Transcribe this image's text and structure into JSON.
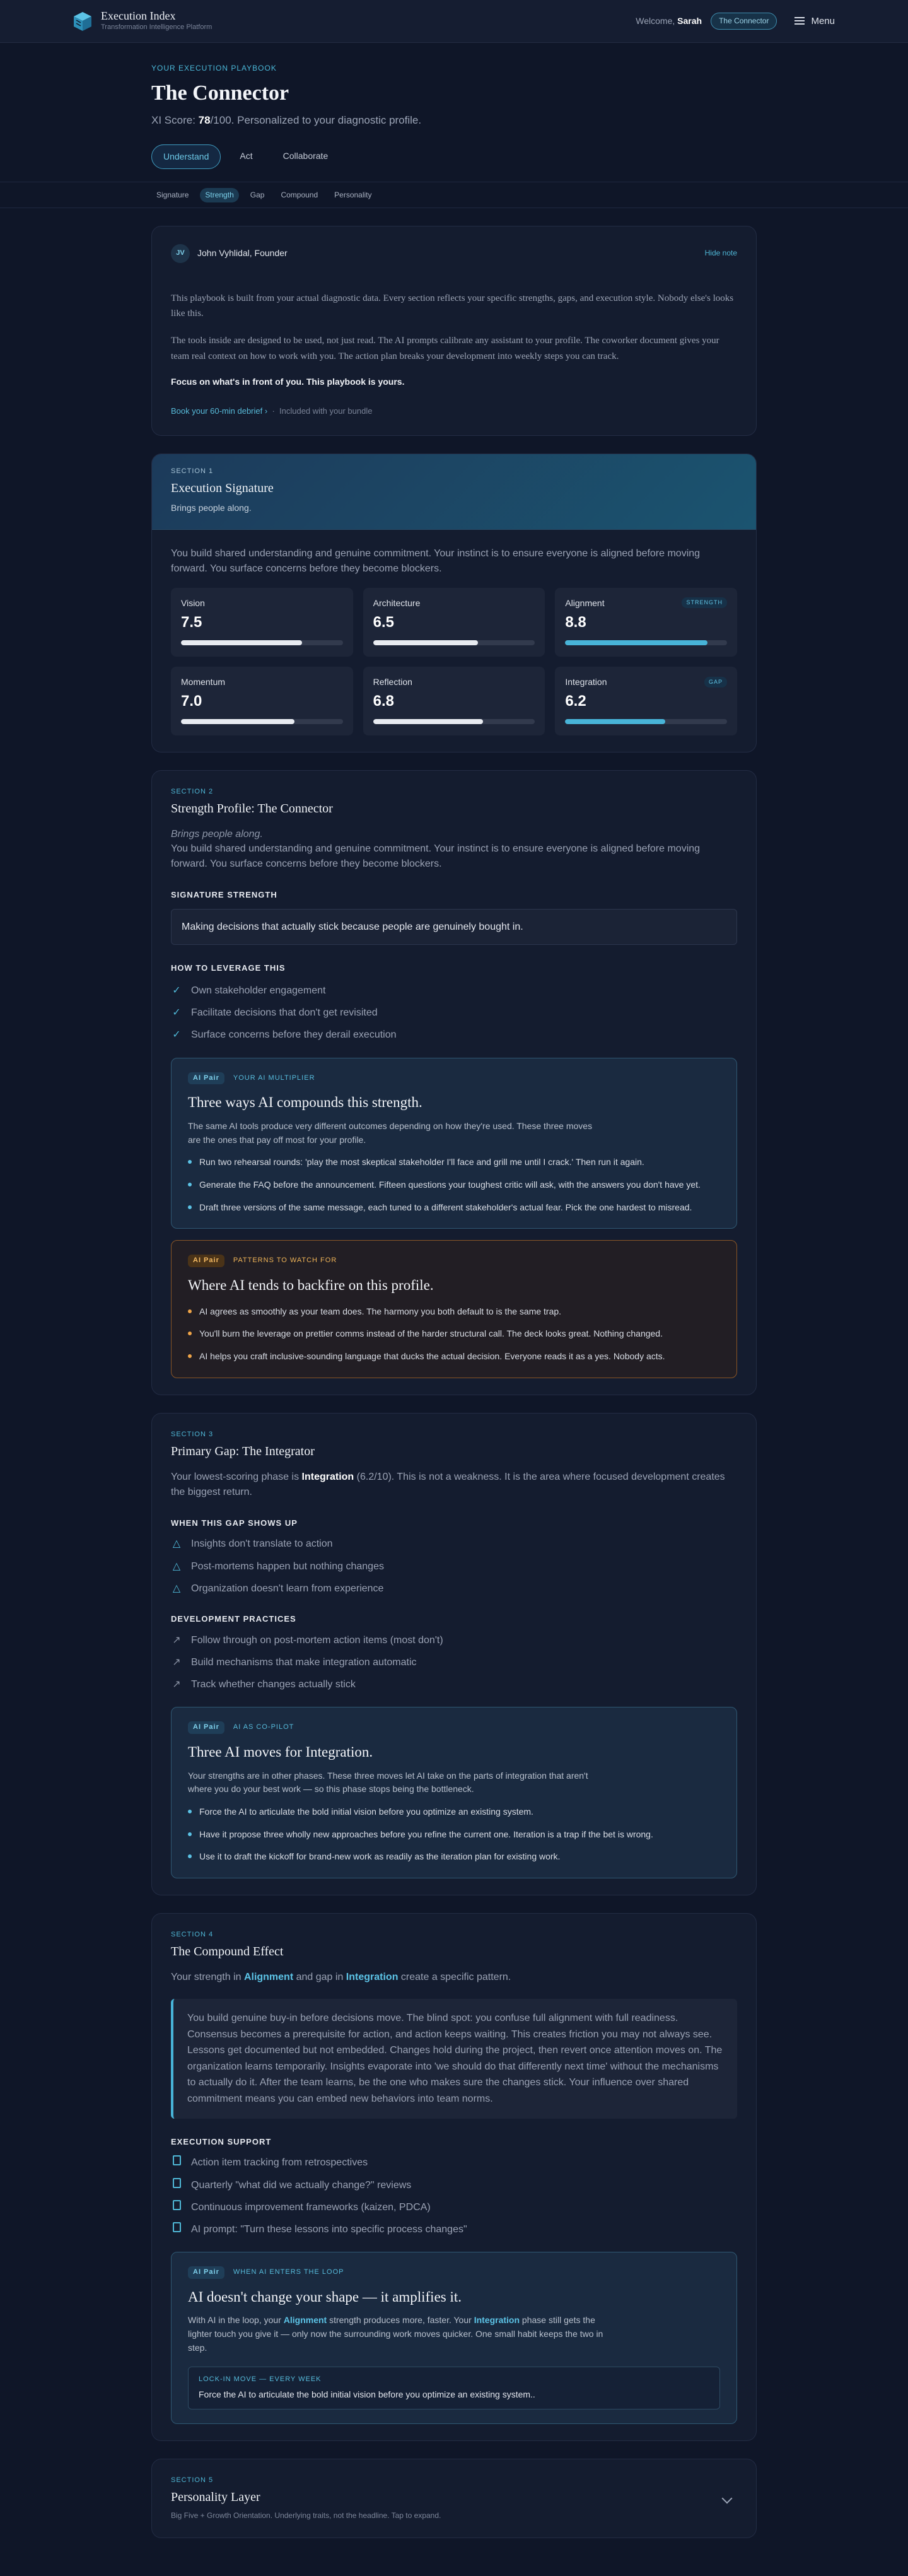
{
  "header": {
    "brand_title": "Execution Index",
    "brand_sub": "Transformation Intelligence Platform",
    "welcome": "Welcome,",
    "user": "Sarah",
    "profile_pill": "The Connector",
    "menu": "Menu"
  },
  "hero": {
    "kicker": "Your Execution Playbook",
    "title": "The Connector",
    "score_prefix": "XI Score:",
    "score": "78",
    "score_suffix": "/100. Personalized to your diagnostic profile."
  },
  "tabs": [
    "Understand",
    "Act",
    "Collaborate"
  ],
  "subnav": [
    "Signature",
    "Strength",
    "Gap",
    "Compound",
    "Personality"
  ],
  "note": {
    "initials": "JV",
    "author": "John Vyhlidal, Founder",
    "hide": "Hide note",
    "p1": "This playbook is built from your actual diagnostic data. Every section reflects your specific strengths, gaps, and execution style. Nobody else's looks like this.",
    "p2": "The tools inside are designed to be used, not just read. The AI prompts calibrate any assistant to your profile. The coworker document gives your team real context on how to work with you. The action plan breaks your development into weekly steps you can track.",
    "focus": "Focus on what's in front of you. This playbook is yours.",
    "book": "Book your 60-min debrief",
    "book_arrow": "›",
    "included": "Included with your bundle"
  },
  "s1": {
    "label": "Section 1",
    "title": "Execution Signature",
    "tag": "Brings people along.",
    "lead": "You build shared understanding and genuine commitment. Your instinct is to ensure everyone is aligned before moving forward. You surface concerns before they become blockers.",
    "metrics": [
      {
        "name": "Vision",
        "value": "7.5",
        "pct": 0.75,
        "badge": ""
      },
      {
        "name": "Architecture",
        "value": "6.5",
        "pct": 0.65,
        "badge": ""
      },
      {
        "name": "Alignment",
        "value": "8.8",
        "pct": 0.88,
        "badge": "Strength"
      },
      {
        "name": "Momentum",
        "value": "7.0",
        "pct": 0.7,
        "badge": ""
      },
      {
        "name": "Reflection",
        "value": "6.8",
        "pct": 0.68,
        "badge": ""
      },
      {
        "name": "Integration",
        "value": "6.2",
        "pct": 0.62,
        "badge": "Gap"
      }
    ]
  },
  "s2": {
    "label": "Section 2",
    "title": "Strength Profile: The Connector",
    "tag": "Brings people along.",
    "lead": "You build shared understanding and genuine commitment. Your instinct is to ensure everyone is aligned before moving forward. You surface concerns before they become blockers.",
    "sig_h": "Signature Strength",
    "sig": "Making decisions that actually stick because people are genuinely bought in.",
    "lev_h": "How to Leverage This",
    "lev": [
      "Own stakeholder engagement",
      "Facilitate decisions that don't get revisited",
      "Surface concerns before they derail execution"
    ],
    "ai1": {
      "pill": "AI Pair",
      "label": "Your AI Multiplier",
      "title": "Three ways AI compounds this strength.",
      "desc": "The same AI tools produce very different outcomes depending on how they're used. These three moves are the ones that pay off most for your profile.",
      "items": [
        "Run two rehearsal rounds: 'play the most skeptical stakeholder I'll face and grill me until I crack.' Then run it again.",
        "Generate the FAQ before the announcement. Fifteen questions your toughest critic will ask, with the answers you don't have yet.",
        "Draft three versions of the same message, each tuned to a different stakeholder's actual fear. Pick the one hardest to misread."
      ]
    },
    "ai2": {
      "pill": "AI Pair",
      "label": "Patterns to watch for",
      "title": "Where AI tends to backfire on this profile.",
      "items": [
        "AI agrees as smoothly as your team does. The harmony you both default to is the same trap.",
        "You'll burn the leverage on prettier comms instead of the harder structural call. The deck looks great. Nothing changed.",
        "AI helps you craft inclusive-sounding language that ducks the actual decision. Everyone reads it as a yes. Nobody acts."
      ]
    }
  },
  "s3": {
    "label": "Section 3",
    "title": "Primary Gap: The Integrator",
    "lead_a": "Your lowest-scoring phase is",
    "phase": "Integration",
    "lead_b": "(6.2/10). This is not a weakness. It is the area where focused development creates the biggest return.",
    "shows_h": "When This Gap Shows Up",
    "shows": [
      "Insights don't translate to action",
      "Post-mortems happen but nothing changes",
      "Organization doesn't learn from experience"
    ],
    "dev_h": "Development Practices",
    "dev": [
      "Follow through on post-mortem action items (most don't)",
      "Build mechanisms that make integration automatic",
      "Track whether changes actually stick"
    ],
    "ai": {
      "pill": "AI Pair",
      "label": "AI as Co-Pilot",
      "title": "Three AI moves for Integration.",
      "desc": "Your strengths are in other phases. These three moves let AI take on the parts of integration that aren't where you do your best work — so this phase stops being the bottleneck.",
      "items": [
        "Force the AI to articulate the bold initial vision before you optimize an existing system.",
        "Have it propose three wholly new approaches before you refine the current one. Iteration is a trap if the bet is wrong.",
        "Use it to draft the kickoff for brand-new work as readily as the iteration plan for existing work."
      ]
    }
  },
  "s4": {
    "label": "Section 4",
    "title": "The Compound Effect",
    "lead_a": "Your strength in",
    "strength": "Alignment",
    "lead_b": "and gap in",
    "gap": "Integration",
    "lead_c": "create a specific pattern.",
    "quote": "You build genuine buy-in before decisions move. The blind spot: you confuse full alignment with full readiness. Consensus becomes a prerequisite for action, and action keeps waiting. This creates friction you may not always see. Lessons get documented but not embedded. Changes hold during the project, then revert once attention moves on. The organization learns temporarily. Insights evaporate into 'we should do that differently next time' without the mechanisms to actually do it. After the team learns, be the one who makes sure the changes stick. Your influence over shared commitment means you can embed new behaviors into team norms.",
    "sup_h": "Execution Support",
    "sup": [
      "Action item tracking from retrospectives",
      "Quarterly \"what did we actually change?\" reviews",
      "Continuous improvement frameworks (kaizen, PDCA)",
      "AI prompt: \"Turn these lessons into specific process changes\""
    ],
    "ai": {
      "pill": "AI Pair",
      "label": "When AI enters the loop",
      "title": "AI doesn't change your shape — it amplifies it.",
      "d1": "With AI in the loop, your",
      "d_strength": "Alignment",
      "d2": "strength produces more, faster. Your",
      "d_gap": "Integration",
      "d3": "phase still gets the lighter touch you give it — only now the surrounding work moves quicker. One small habit keeps the two in step.",
      "lock_lbl": "Lock-in move — every week",
      "lock": "Force the AI to articulate the bold initial vision before you optimize an existing system.."
    }
  },
  "s5": {
    "label": "Section 5",
    "title": "Personality Layer",
    "desc": "Big Five + Growth Orientation. Underlying traits, not the headline. Tap to expand."
  }
}
